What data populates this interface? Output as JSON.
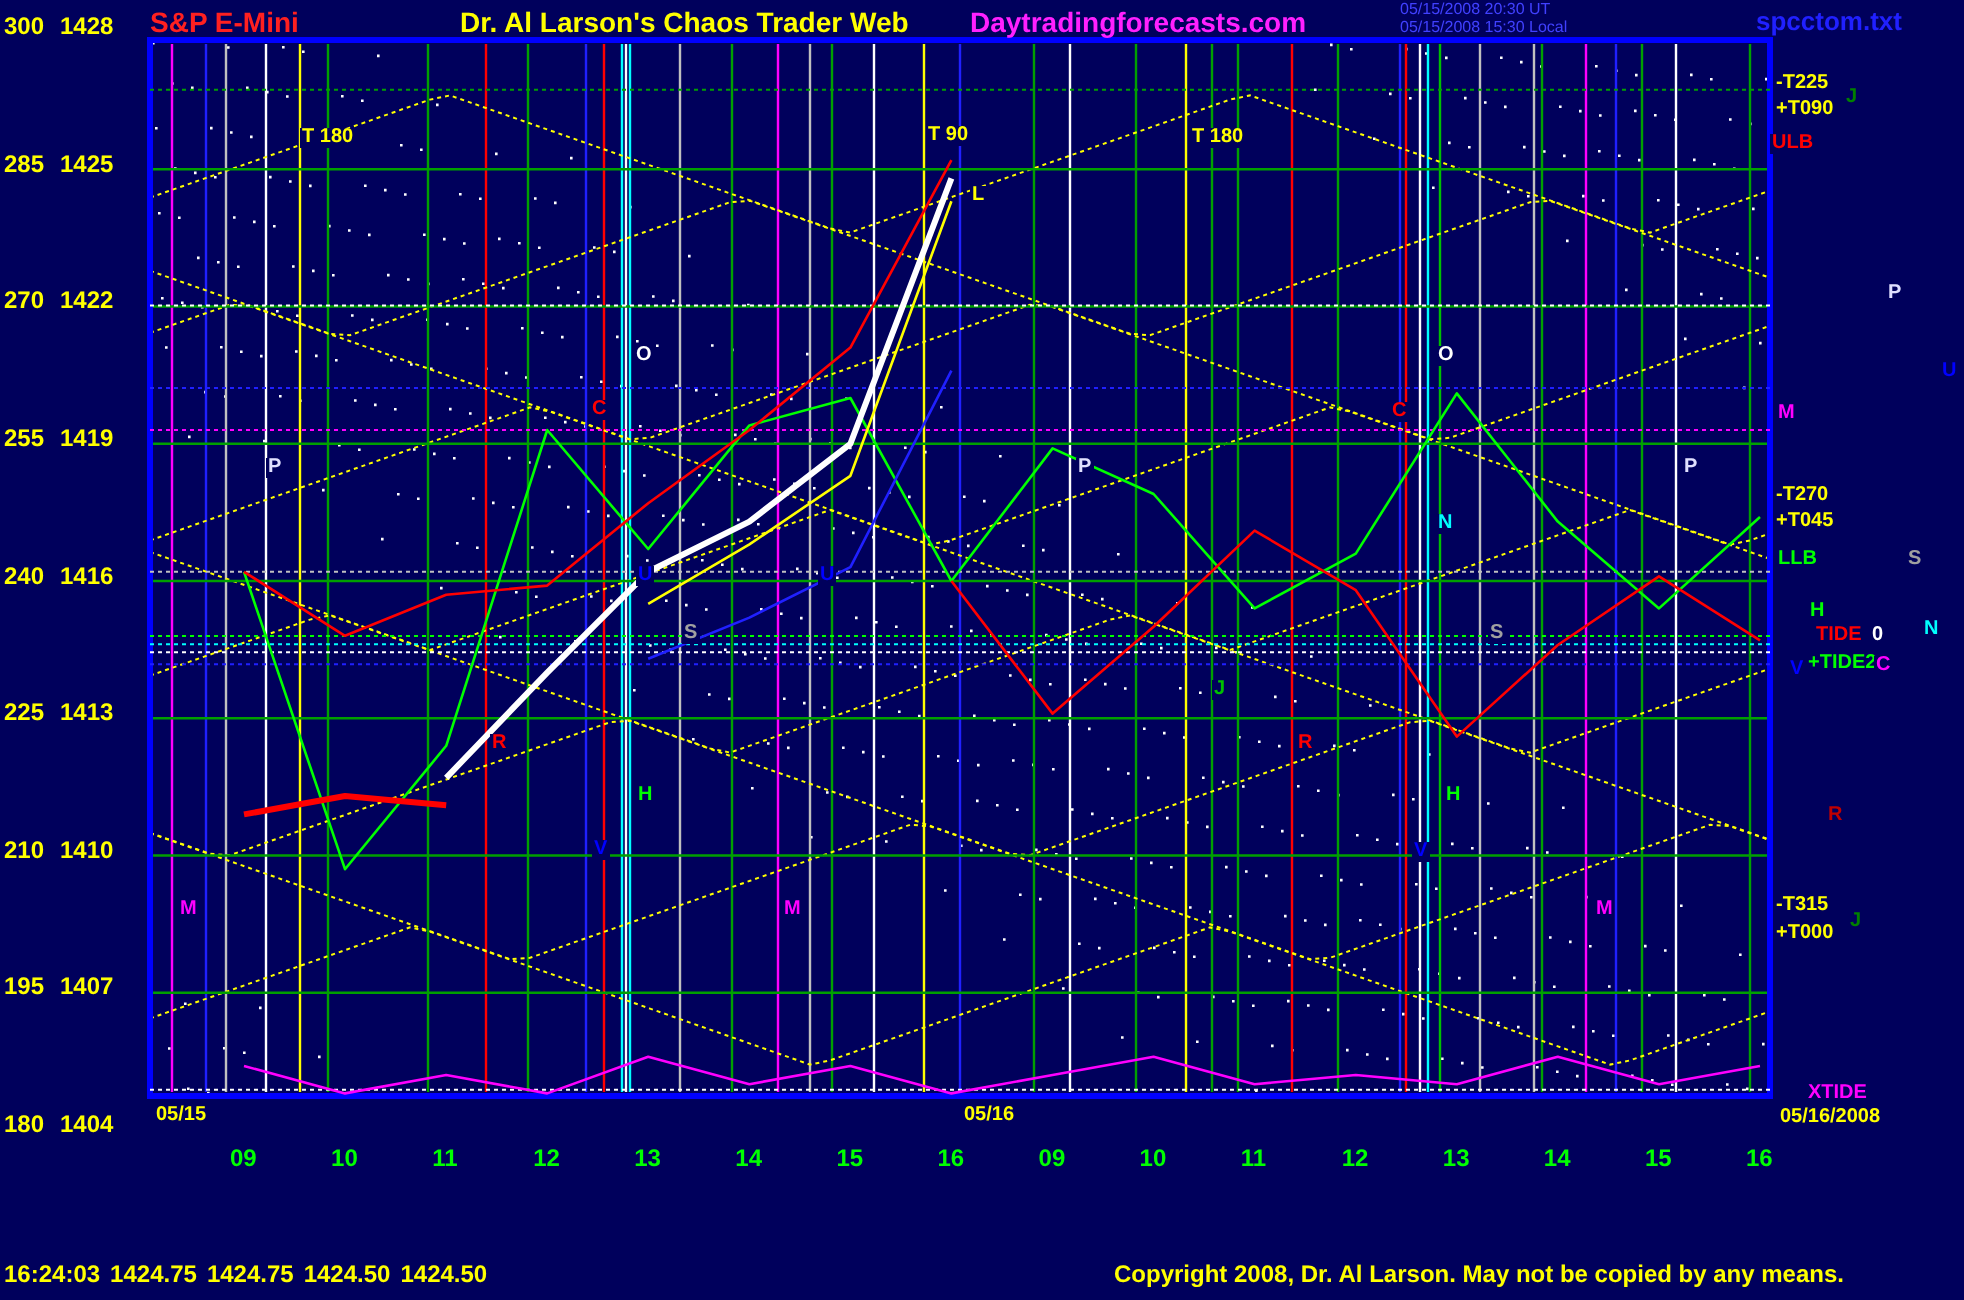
{
  "header": {
    "symbol": "S&P E-Mini",
    "title": "Dr. Al Larson's Chaos Trader Web",
    "site": "Daytradingforecasts.com",
    "timestamps": [
      "05/15/2008 20:30 UT",
      "05/15/2008 15:30 Local"
    ],
    "file": "spcctom.txt"
  },
  "price_axis": [
    "1428",
    "1425",
    "1422",
    "1419",
    "1416",
    "1413",
    "1410",
    "1407",
    "1404"
  ],
  "chart": {
    "chart_data": {
      "type": "line",
      "grid": true,
      "ref_lines": [
        {
          "axis": "y",
          "value": 293.7,
          "color": "#00a000"
        },
        {
          "axis": "y",
          "value": 270.1,
          "color": "#ffffff"
        },
        {
          "axis": "y",
          "value": 261.1,
          "color": "#2020ff"
        },
        {
          "axis": "y",
          "value": 256.5,
          "color": "#ff00ff"
        },
        {
          "axis": "y",
          "value": 241,
          "color": "#c0c0c0"
        },
        {
          "axis": "y",
          "value": 234,
          "color": "#00ff00"
        },
        {
          "axis": "y",
          "value": 233.1,
          "color": "#00ffff"
        },
        {
          "axis": "y",
          "value": 232.2,
          "color": "#ffffff"
        },
        {
          "axis": "y",
          "value": 230.9,
          "color": "#2020ff"
        },
        {
          "axis": "y",
          "value": 184.4,
          "color": "#ffffff"
        }
      ],
      "categories": [
        "09",
        "10",
        "11",
        "12",
        "13",
        "14",
        "15",
        "16",
        "09",
        "10",
        "11",
        "12",
        "13",
        "14",
        "15",
        "16"
      ],
      "ylim": [
        180,
        300
      ],
      "yticks": [
        {
          "value": 300,
          "label": "300"
        },
        {
          "value": 285,
          "label": "285"
        },
        {
          "value": 270,
          "label": "270"
        },
        {
          "value": 255,
          "label": "255"
        },
        {
          "value": 240,
          "label": "240"
        },
        {
          "value": 225,
          "label": "225"
        },
        {
          "value": 210,
          "label": "210"
        },
        {
          "value": 195,
          "label": "195"
        },
        {
          "value": 180,
          "label": "180"
        }
      ],
      "series": [
        {
          "color": "#00ff00",
          "values": [
            241,
            208.5,
            222,
            256.5,
            243.5,
            257,
            260,
            240,
            254.5,
            249.5,
            237,
            243,
            260.5,
            246.5,
            237,
            247
          ]
        },
        {
          "color": "#ff0000",
          "values": [
            241,
            234,
            238.5,
            239.5,
            248.5,
            256.5,
            265.5,
            286,
            null,
            null,
            null,
            null,
            null,
            null,
            null,
            null
          ]
        },
        {
          "color": "#ff0000",
          "values": [
            null,
            null,
            null,
            null,
            null,
            null,
            null,
            240,
            225.5,
            235,
            245.5,
            239,
            223,
            233,
            240.5,
            233.5
          ]
        },
        {
          "color": "#2020ff",
          "values": [
            null,
            null,
            null,
            null,
            231.5,
            236,
            241.5,
            263,
            null,
            null,
            null,
            null,
            null,
            null,
            null,
            null
          ]
        },
        {
          "color": "#ffff00",
          "values": [
            null,
            null,
            null,
            null,
            237.5,
            244,
            251.5,
            281.5,
            null,
            null,
            null,
            null,
            null,
            null,
            null,
            null
          ]
        },
        {
          "color": "#ff0000",
          "values": [
            214.5,
            216.5,
            215.5,
            null,
            null,
            null,
            null,
            null,
            null,
            null,
            null,
            null,
            null,
            null,
            null,
            null
          ]
        },
        {
          "color": "#ffffff",
          "values": [
            null,
            null,
            218.5,
            230,
            241,
            246.5,
            255,
            284,
            null,
            null,
            null,
            null,
            null,
            null,
            null,
            null
          ]
        },
        {
          "name": "XTIDE",
          "color": "#ff00ff",
          "values": [
            187,
            184,
            186,
            184,
            188,
            185,
            187,
            184,
            186,
            188,
            185,
            186,
            185,
            188,
            185,
            187
          ]
        }
      ]
    }
  },
  "chart_labels": [
    {
      "text": "T 180",
      "color": "#ffff00"
    },
    {
      "text": "T 90",
      "color": "#ffff00"
    },
    {
      "text": "T 180",
      "color": "#ffff00"
    },
    {
      "text": "L",
      "color": "#ffff00"
    },
    {
      "text": "-T225",
      "color": "#ffff00"
    },
    {
      "text": "J",
      "color": "#008000"
    },
    {
      "text": "+T090",
      "color": "#ffff00"
    },
    {
      "text": "ULB",
      "color": "#ff0000"
    },
    {
      "text": "P",
      "color": "#e0e0ff"
    },
    {
      "text": "O",
      "color": "#ffffff"
    },
    {
      "text": "O",
      "color": "#ffffff"
    },
    {
      "text": "C",
      "color": "#ff0000"
    },
    {
      "text": "C",
      "color": "#ff0000"
    },
    {
      "text": "U",
      "color": "#0000ff"
    },
    {
      "text": "M",
      "color": "#ff00ff"
    },
    {
      "text": "P",
      "color": "#e0e0ff"
    },
    {
      "text": "P",
      "color": "#e0e0ff"
    },
    {
      "text": "P",
      "color": "#e0e0ff"
    },
    {
      "text": "-T270",
      "color": "#ffff00"
    },
    {
      "text": "+T045",
      "color": "#ffff00"
    },
    {
      "text": "N",
      "color": "#00ffff"
    },
    {
      "text": "LLB",
      "color": "#00ff00"
    },
    {
      "text": "S",
      "color": "#a0a0a0"
    },
    {
      "text": "U",
      "color": "#0000ff"
    },
    {
      "text": "U",
      "color": "#0000ff"
    },
    {
      "text": "H",
      "color": "#00ff00"
    },
    {
      "text": "TIDE",
      "color": "#ff0000"
    },
    {
      "text": "0",
      "color": "#ffffff"
    },
    {
      "text": "N",
      "color": "#00ffff"
    },
    {
      "text": "+TIDE2",
      "color": "#00ff00"
    },
    {
      "text": "V",
      "color": "#0000ff"
    },
    {
      "text": "C",
      "color": "#ff00ff"
    },
    {
      "text": "S",
      "color": "#a0a0a0"
    },
    {
      "text": "S",
      "color": "#a0a0a0"
    },
    {
      "text": "J",
      "color": "#00c000"
    },
    {
      "text": "R",
      "color": "#ff0000"
    },
    {
      "text": "R",
      "color": "#ff0000"
    },
    {
      "text": "H",
      "color": "#00ff00"
    },
    {
      "text": "H",
      "color": "#00ff00"
    },
    {
      "text": "R",
      "color": "#c00000"
    },
    {
      "text": "V",
      "color": "#0000ff"
    },
    {
      "text": "V",
      "color": "#0000ff"
    },
    {
      "text": "M",
      "color": "#ff00ff"
    },
    {
      "text": "M",
      "color": "#ff00ff"
    },
    {
      "text": "M",
      "color": "#ff00ff"
    },
    {
      "text": "-T315",
      "color": "#ffff00"
    },
    {
      "text": "J",
      "color": "#008000"
    },
    {
      "text": "+T000",
      "color": "#ffff00"
    },
    {
      "text": "05/15",
      "color": "#ffff00"
    },
    {
      "text": "05/16",
      "color": "#ffff00"
    },
    {
      "text": "05/16/2008",
      "color": "#ffff00"
    }
  ],
  "footer": {
    "quote": [
      "16:24:03",
      "1424.75",
      "1424.75",
      "1424.50",
      "1424.50"
    ],
    "copyright": "Copyright 2008, Dr. Al Larson. May not be copied by any means."
  }
}
